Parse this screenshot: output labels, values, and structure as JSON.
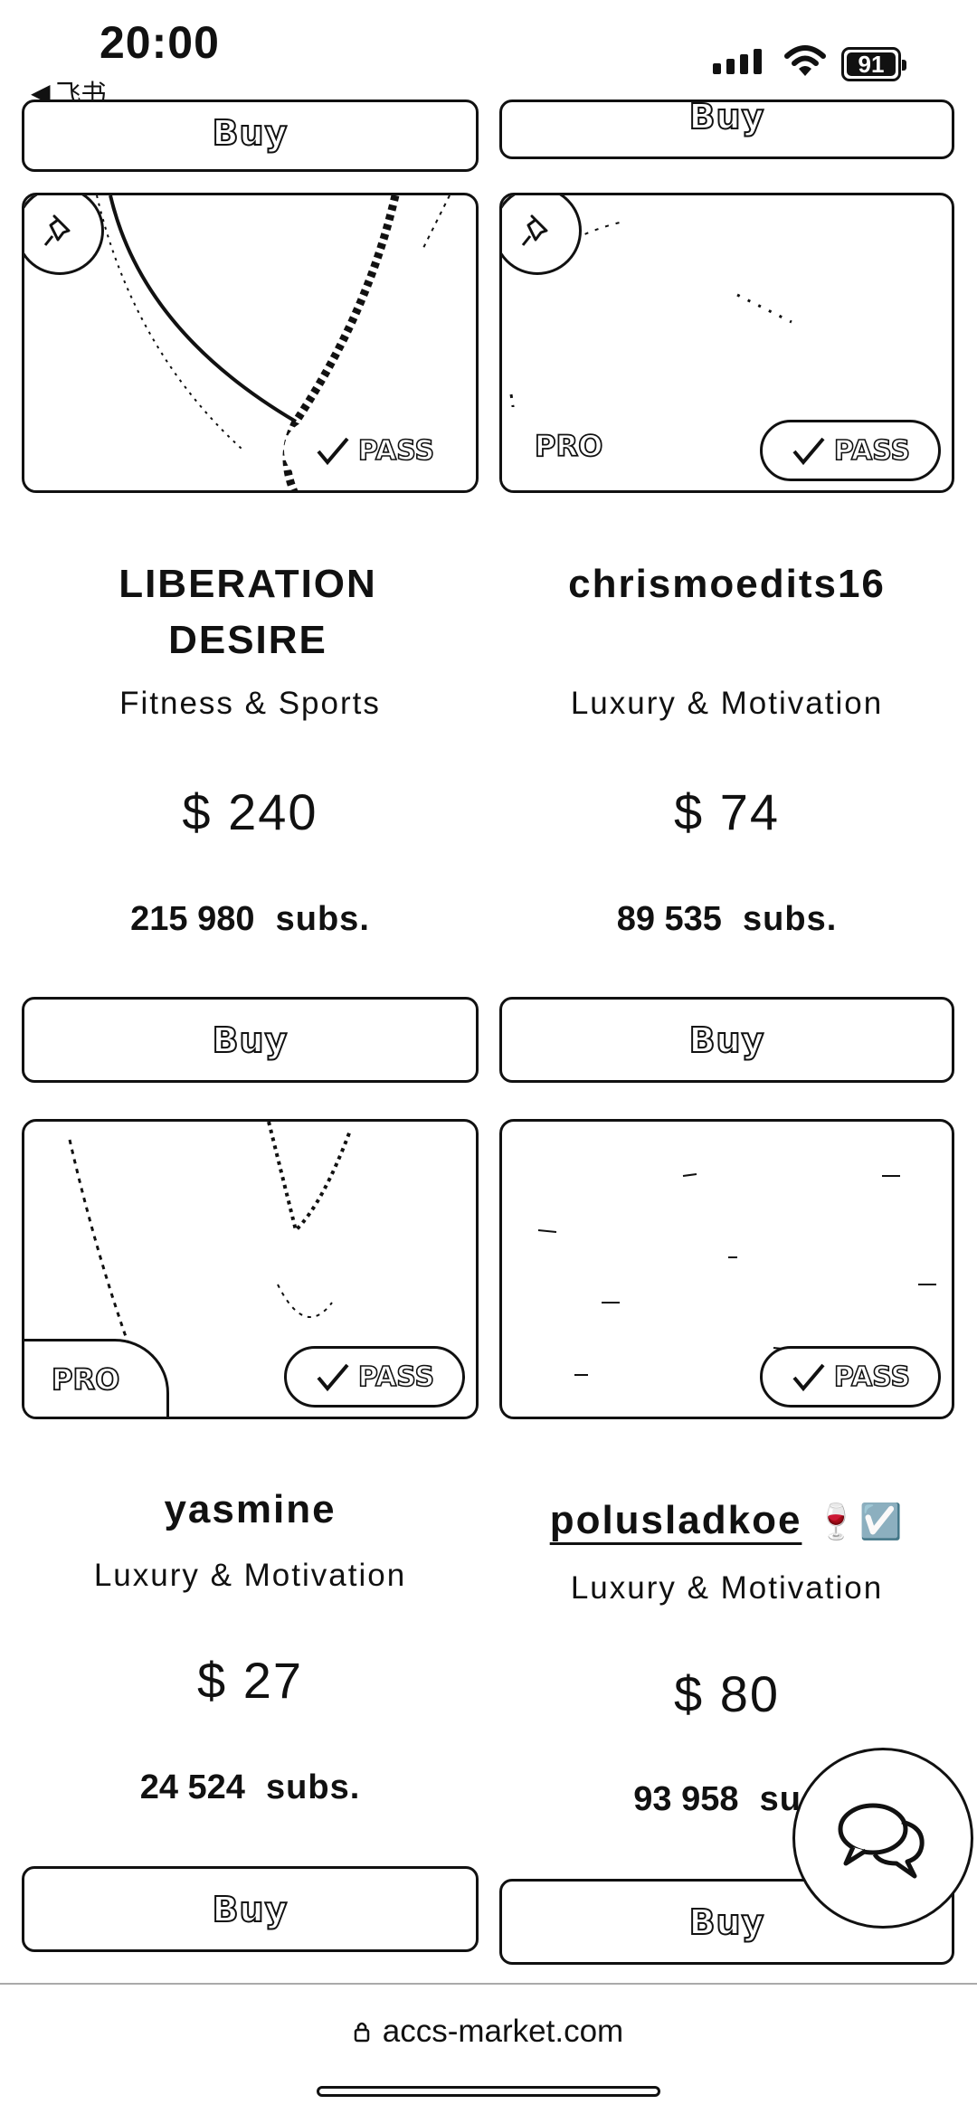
{
  "status_bar": {
    "time": "20:00",
    "back_app": "飞书",
    "battery": "91"
  },
  "cards": [
    {
      "id": "top-left-partial",
      "buy_label": "Buy"
    },
    {
      "id": "top-right-partial",
      "buy_label": "Buy"
    },
    {
      "name": "LIBERATION DESIRE",
      "category": "Fitness & Sports",
      "price": "$ 240",
      "subs_count": "215 980",
      "subs_unit": "subs.",
      "pass_label": "PASS",
      "pinned": true,
      "pro": false,
      "buy_label": "Buy"
    },
    {
      "name": "chrismoedits16",
      "category": "Luxury & Motivation",
      "price": "$ 74",
      "subs_count": "89 535",
      "subs_unit": "subs.",
      "pass_label": "PASS",
      "pro_label": "PRO",
      "pinned": true,
      "pro": true,
      "buy_label": "Buy"
    },
    {
      "name": "yasmine",
      "category": "Luxury & Motivation",
      "price": "$ 27",
      "subs_count": "24 524",
      "subs_unit": "subs.",
      "pass_label": "PASS",
      "pro_label": "PRO",
      "pinned": false,
      "pro": true,
      "buy_label": "Buy"
    },
    {
      "name": "polusladkoe",
      "category": "Luxury & Motivation",
      "price": "$ 80",
      "subs_count": "93 958",
      "subs_unit": "su",
      "pass_label": "PASS",
      "pinned": false,
      "pro": false,
      "buy_label": "Buy",
      "name_emoji": "🍷☑️"
    }
  ],
  "browser": {
    "domain": "accs-market.com"
  },
  "icons": {
    "pin": "pushpin-icon",
    "check": "checkmark-icon",
    "chat": "chat-bubbles-icon",
    "lock": "lock-icon"
  }
}
